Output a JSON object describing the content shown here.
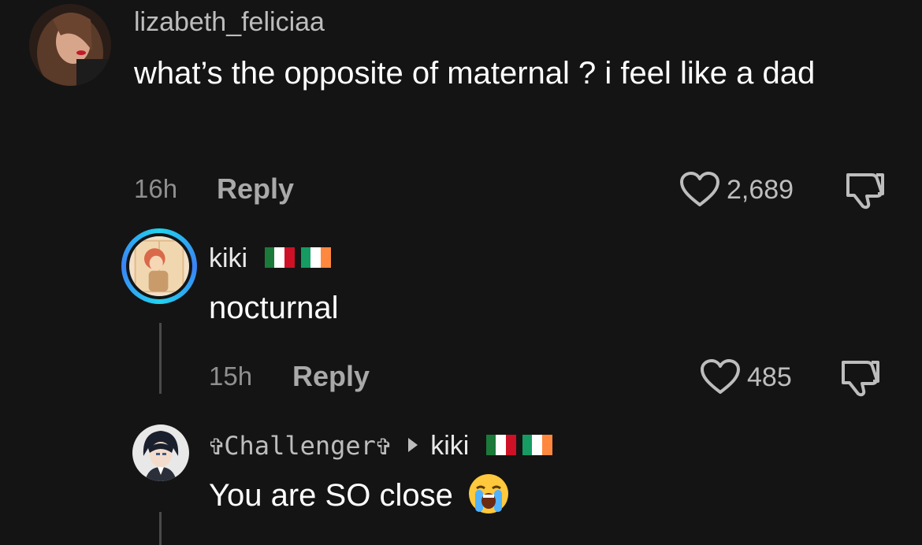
{
  "comments": [
    {
      "username": "lizabeth_feliciaa",
      "text": "what’s the opposite of maternal ? i feel like a dad",
      "time": "16h",
      "reply_label": "Reply",
      "likes": "2,689"
    },
    {
      "username": "kiki",
      "text": "nocturnal",
      "time": "15h",
      "reply_label": "Reply",
      "likes": "485",
      "flags": [
        "mexico-flag",
        "ireland-flag"
      ]
    },
    {
      "username": "✞Challenger✞",
      "reply_to": "kiki",
      "text": "You are SO close",
      "emoji": "loudly-crying-face",
      "flags": [
        "mexico-flag",
        "ireland-flag"
      ]
    }
  ],
  "colors": {
    "background": "#141414",
    "ring_accent": "#22d3ee",
    "muted_text": "#8f8f8f"
  },
  "icons": {
    "like": "heart-outline-icon",
    "dislike": "thumbs-down-icon"
  }
}
